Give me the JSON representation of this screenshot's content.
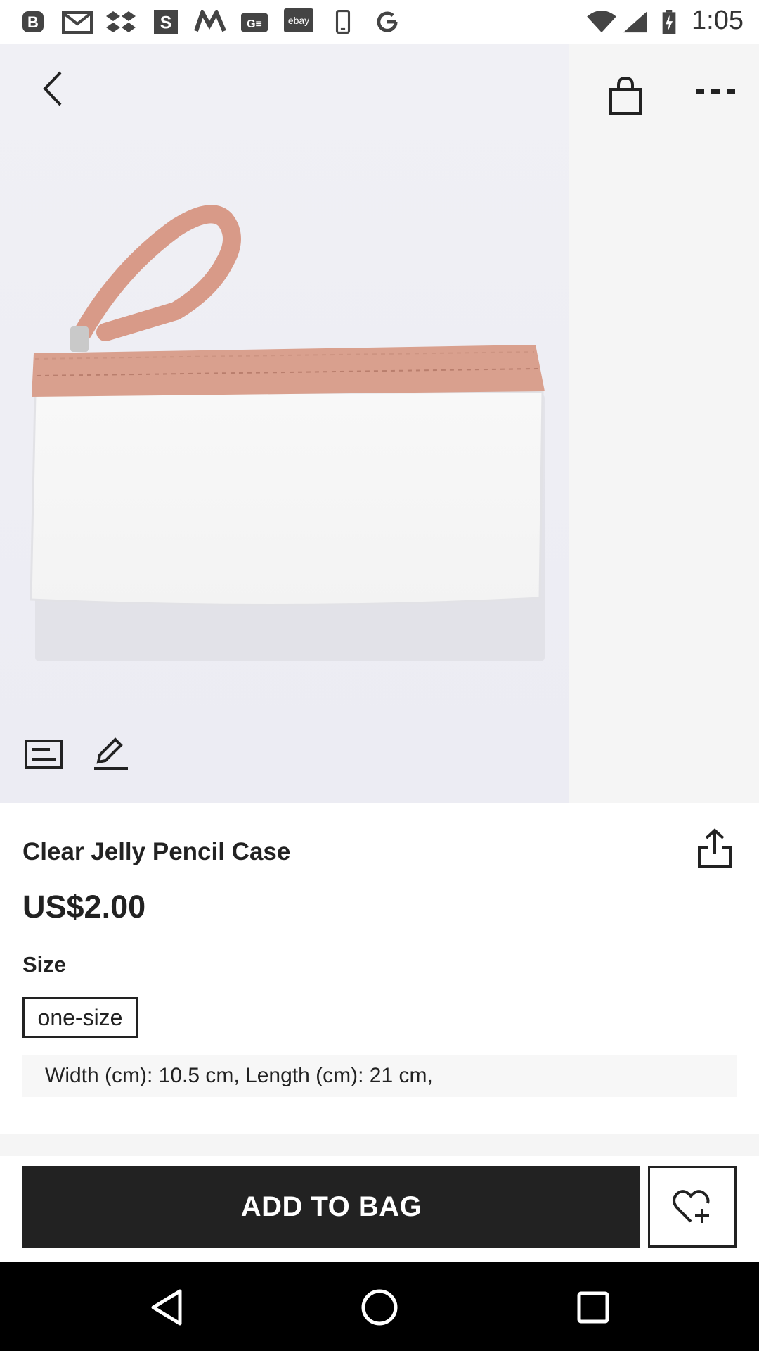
{
  "status_bar": {
    "time": "1:05",
    "left_icons": [
      "b-icon",
      "gmail-icon",
      "dropbox-icon",
      "s-app-icon",
      "m-app-icon",
      "ge-icon",
      "ebay-icon",
      "phone-icon",
      "google-icon"
    ],
    "ebay_text": "ebay",
    "right_icons": [
      "wifi-icon",
      "cell-signal-icon",
      "battery-charging-icon"
    ]
  },
  "product": {
    "title": "Clear Jelly Pencil Case",
    "price": "US$2.00",
    "size_label": "Size",
    "selected_size": "one-size",
    "measurements": "Width (cm): 10.5 cm, Length (cm): 21 cm,"
  },
  "actions": {
    "add_to_bag": "ADD TO BAG"
  },
  "colors": {
    "primary": "#222222",
    "strap": "#d99a88"
  }
}
